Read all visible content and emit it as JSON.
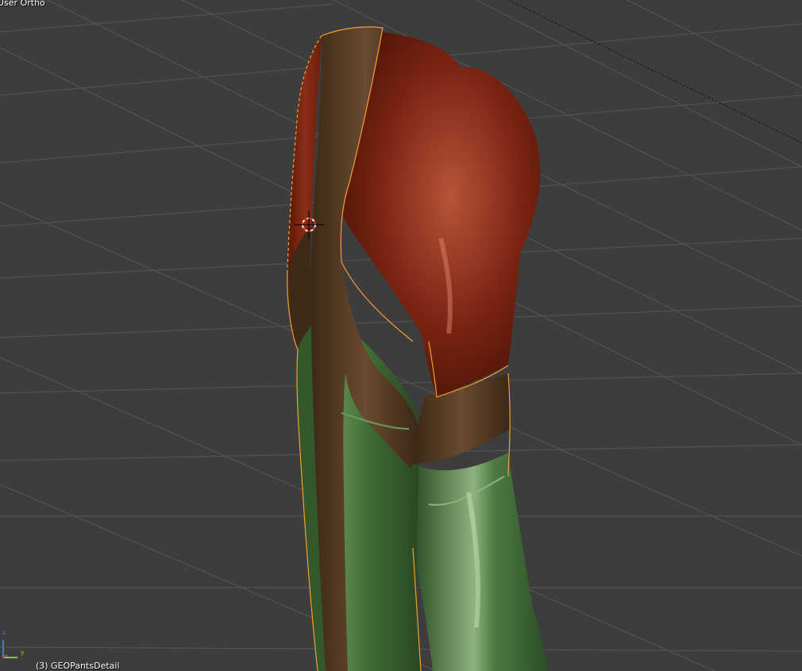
{
  "viewport": {
    "view_label": "User Ortho",
    "object_label": "(3) GEOPantsDetail",
    "background": "#3d3d3d",
    "grid_color": "#5a5a5a"
  },
  "gizmo": {
    "z_label": "z",
    "y_label": "y",
    "x_color": "#e0443a",
    "y_color": "#7fc93e",
    "z_color": "#4a74d6"
  },
  "model": {
    "name": "GEOPantsDetail",
    "panel_colors": {
      "red": "#7a2412",
      "brown": "#4a3320",
      "green": "#3e6a34"
    },
    "selection_outline_color": "#f0a030",
    "cursor_icon": "3d-cursor-icon"
  }
}
